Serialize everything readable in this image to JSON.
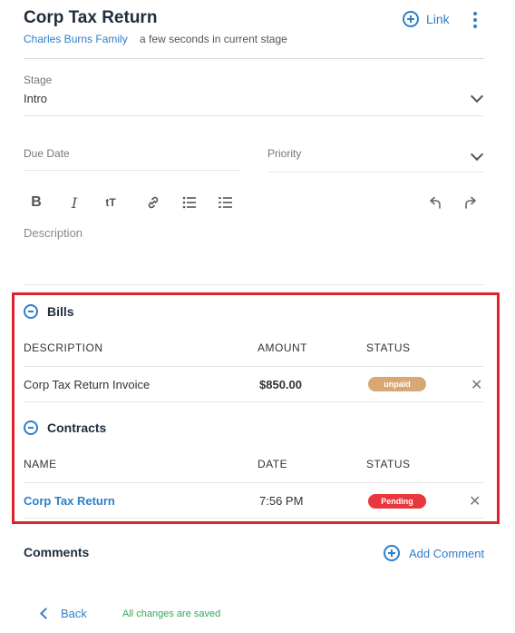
{
  "header": {
    "title": "Corp Tax Return",
    "client": "Charles Burns Family",
    "stage_time": "a few seconds in current stage",
    "link_label": "Link"
  },
  "stage": {
    "label": "Stage",
    "value": "Intro"
  },
  "due_date": {
    "placeholder": "Due Date"
  },
  "priority": {
    "placeholder": "Priority"
  },
  "toolbar": [
    "bold-icon",
    "italic-icon",
    "text-size-icon",
    "link-icon",
    "bullet-list-icon",
    "numbered-list-icon",
    "undo-icon",
    "redo-icon"
  ],
  "description": {
    "placeholder": "Description"
  },
  "bills": {
    "heading": "Bills",
    "columns": [
      "DESCRIPTION",
      "AMOUNT",
      "STATUS"
    ],
    "rows": [
      {
        "description": "Corp Tax Return Invoice",
        "amount": "$850.00",
        "status": "unpaid"
      }
    ]
  },
  "contracts": {
    "heading": "Contracts",
    "columns": [
      "NAME",
      "DATE",
      "STATUS"
    ],
    "rows": [
      {
        "name": "Corp Tax Return",
        "date": "7:56 PM",
        "status": "Pending"
      }
    ]
  },
  "comments": {
    "heading": "Comments",
    "add_label": "Add Comment"
  },
  "footer": {
    "back_label": "Back",
    "saved_text": "All changes are saved"
  },
  "colors": {
    "accent": "#2f7fc7",
    "unpaid": "#d8a773",
    "pending": "#e8373d",
    "highlight": "#e0212f"
  }
}
